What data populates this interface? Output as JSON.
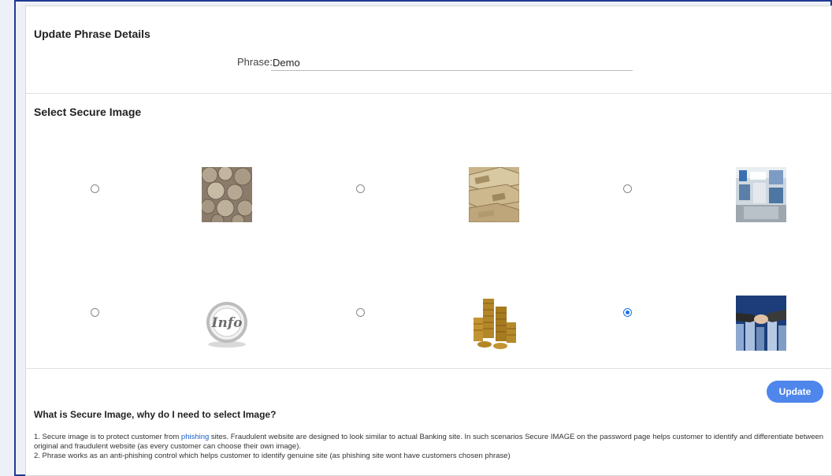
{
  "phrase_section": {
    "title": "Update Phrase Details",
    "phrase_label": "Phrase:",
    "phrase_value": "Demo"
  },
  "image_section": {
    "title": "Select Secure Image",
    "options": [
      {
        "image": "coins-pile-image",
        "selected": false
      },
      {
        "image": "banknotes-image",
        "selected": false
      },
      {
        "image": "bank-branch-image",
        "selected": false
      },
      {
        "image": "info-badge-image",
        "selected": false
      },
      {
        "image": "coin-stacks-image",
        "selected": false
      },
      {
        "image": "handshake-image",
        "selected": true
      }
    ]
  },
  "actions": {
    "update_label": "Update"
  },
  "faq": {
    "title": "What is Secure Image, why do I need to select Image?",
    "item1_prefix": "1. Secure image is to protect customer from ",
    "item1_link": "phishing",
    "item1_suffix": " sites. Fraudulent website are designed to look similar to actual Banking site. In such scenarios Secure IMAGE on the password page helps customer to identify and differentiate between original and fraudulent website (as every customer can choose their own image).",
    "item2": "2. Phrase works as an anti-phishing control which helps customer to identify genuine site (as phishing site wont have customers chosen phrase)"
  },
  "colors": {
    "frame_border": "#1f3a93",
    "accent": "#4f86ec",
    "link": "#1a5fc8"
  }
}
